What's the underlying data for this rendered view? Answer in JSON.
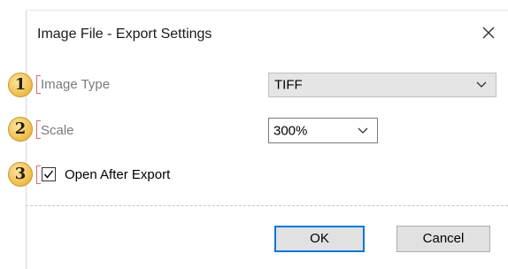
{
  "dialog": {
    "title": "Image File - Export Settings"
  },
  "callouts": [
    "1",
    "2",
    "3"
  ],
  "image_type": {
    "label": "Image Type",
    "value": "TIFF"
  },
  "scale": {
    "label": "Scale",
    "value": "300%"
  },
  "open_after_export": {
    "label": "Open After Export",
    "checked": true
  },
  "buttons": {
    "ok": "OK",
    "cancel": "Cancel"
  },
  "icons": {
    "close": "close-icon",
    "dropdown": "chevron-down-icon",
    "check": "checkmark-icon"
  },
  "colors": {
    "callout_fill": "#f2c45a",
    "bracket": "#e06a6a",
    "ok_border": "#0078d7"
  }
}
